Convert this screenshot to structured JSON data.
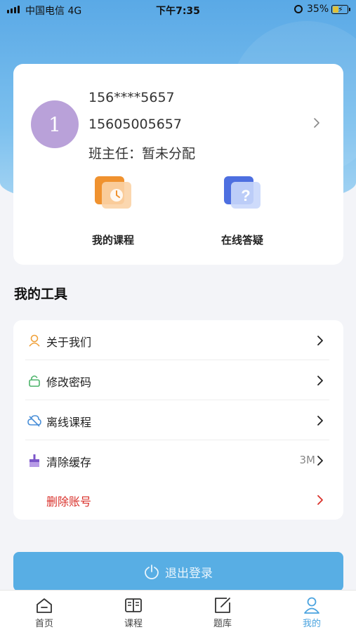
{
  "status_bar": {
    "carrier": "中国电信  4G",
    "time": "下午7:35",
    "battery": "35%"
  },
  "profile": {
    "avatar_letter": "1",
    "masked_phone": "156****5657",
    "phone": "15605005657",
    "head_teacher": "班主任：暂未分配",
    "avatar_color": "#b9a1d9"
  },
  "shortcuts": [
    {
      "label": "我的课程",
      "icon": "clock-book-icon"
    },
    {
      "label": "在线答疑",
      "icon": "question-icon"
    }
  ],
  "tools_section": {
    "title": "我的工具",
    "items": [
      {
        "label": "关于我们",
        "value": "",
        "icon": "person-icon"
      },
      {
        "label": "修改密码",
        "value": "",
        "icon": "lock-icon"
      },
      {
        "label": "离线课程",
        "value": "",
        "icon": "cloud-icon"
      },
      {
        "label": "清除缓存",
        "value": "3M",
        "icon": "broom-icon"
      },
      {
        "label": "删除账号",
        "value": "",
        "icon": ""
      }
    ]
  },
  "logout": {
    "label": "退出登录"
  },
  "tab_bar": {
    "tabs": [
      {
        "label": "首页",
        "icon": "home-icon"
      },
      {
        "label": "课程",
        "icon": "book-icon"
      },
      {
        "label": "题库",
        "icon": "edit-icon"
      },
      {
        "label": "我的",
        "icon": "user-icon"
      }
    ],
    "active": "我的"
  },
  "colors": {
    "accent": "#4aa3df",
    "logout_button": "#58aee4",
    "danger": "#d9312b"
  }
}
